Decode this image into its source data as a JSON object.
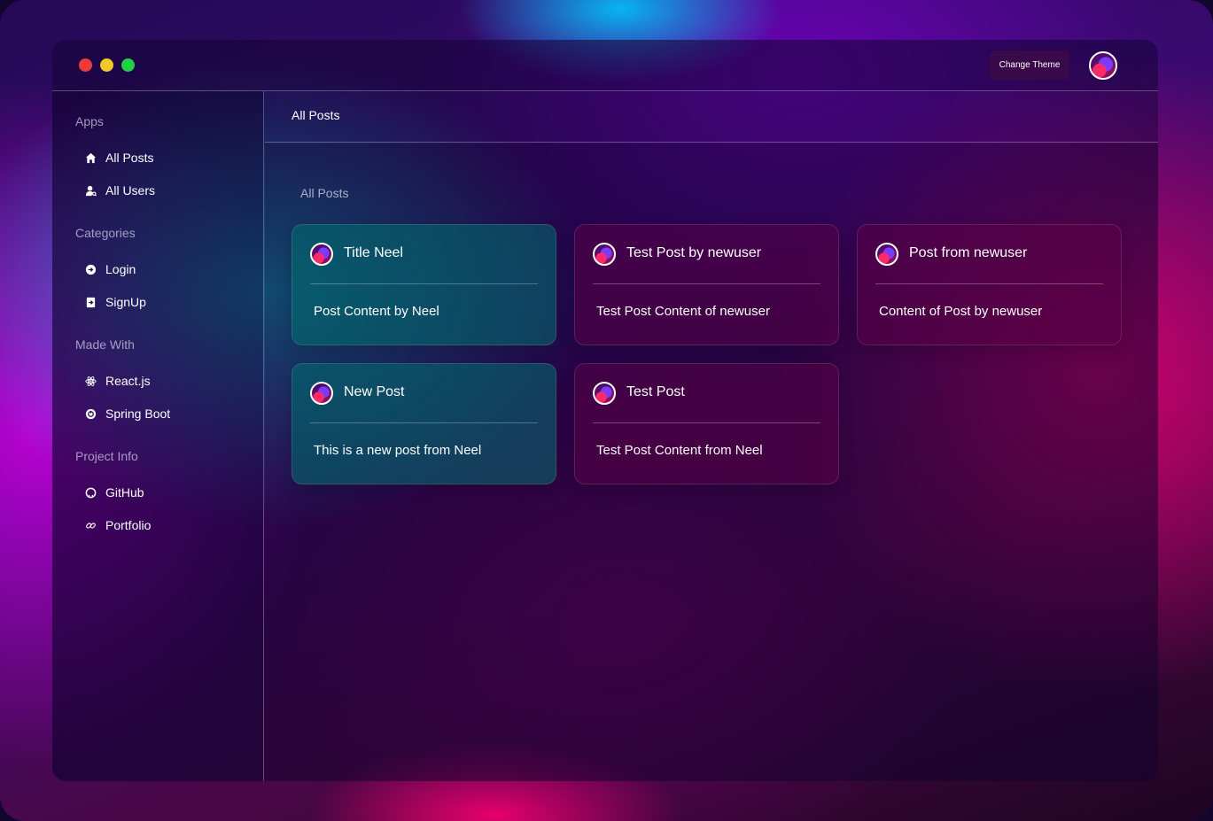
{
  "header": {
    "change_theme_label": "Change Theme",
    "avatar_icon": "user-avatar"
  },
  "sidebar": {
    "sections": [
      {
        "title": "Apps",
        "items": [
          {
            "label": "All Posts",
            "icon": "home-icon"
          },
          {
            "label": "All Users",
            "icon": "user-icon"
          }
        ]
      },
      {
        "title": "Categories",
        "items": [
          {
            "label": "Login",
            "icon": "login-icon"
          },
          {
            "label": "SignUp",
            "icon": "signup-icon"
          }
        ]
      },
      {
        "title": "Made With",
        "items": [
          {
            "label": "React.js",
            "icon": "react-icon"
          },
          {
            "label": "Spring Boot",
            "icon": "spring-icon"
          }
        ]
      },
      {
        "title": "Project Info",
        "items": [
          {
            "label": "GitHub",
            "icon": "github-icon"
          },
          {
            "label": "Portfolio",
            "icon": "link-icon"
          }
        ]
      }
    ]
  },
  "main": {
    "header_title": "All Posts",
    "section_heading": "All Posts",
    "posts": [
      {
        "title": "Title Neel",
        "content": "Post Content by Neel"
      },
      {
        "title": "Test Post by newuser",
        "content": "Test Post Content of newuser"
      },
      {
        "title": "Post from newuser",
        "content": "Content of Post by newuser"
      },
      {
        "title": "New Post",
        "content": "This is a new post from Neel"
      },
      {
        "title": "Test Post",
        "content": "Test Post Content from Neel"
      }
    ]
  },
  "colors": {
    "card_teal": "#006e6e",
    "card_plum": "#5a0046",
    "traffic_red": "#ee3a3a",
    "traffic_yellow": "#f2c72a",
    "traffic_green": "#20d145"
  }
}
